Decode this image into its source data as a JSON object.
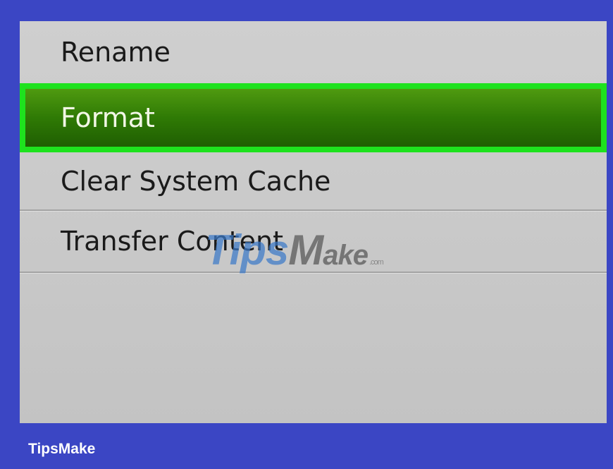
{
  "menu": {
    "items": [
      {
        "label": "Rename",
        "selected": false
      },
      {
        "label": "Format",
        "selected": true
      },
      {
        "label": "Clear System Cache",
        "selected": false
      },
      {
        "label": "Transfer Content",
        "selected": false
      }
    ]
  },
  "watermark": {
    "text_blue": "Tips",
    "text_gray": "M",
    "text_gray_small": "ake",
    "suffix": ".com"
  },
  "footer": {
    "brand": "TipsMake"
  },
  "colors": {
    "frame": "#3b46c4",
    "panel": "#c8c8c8",
    "selected_fill": "#2f7a05",
    "selected_border": "#1ee21e"
  }
}
